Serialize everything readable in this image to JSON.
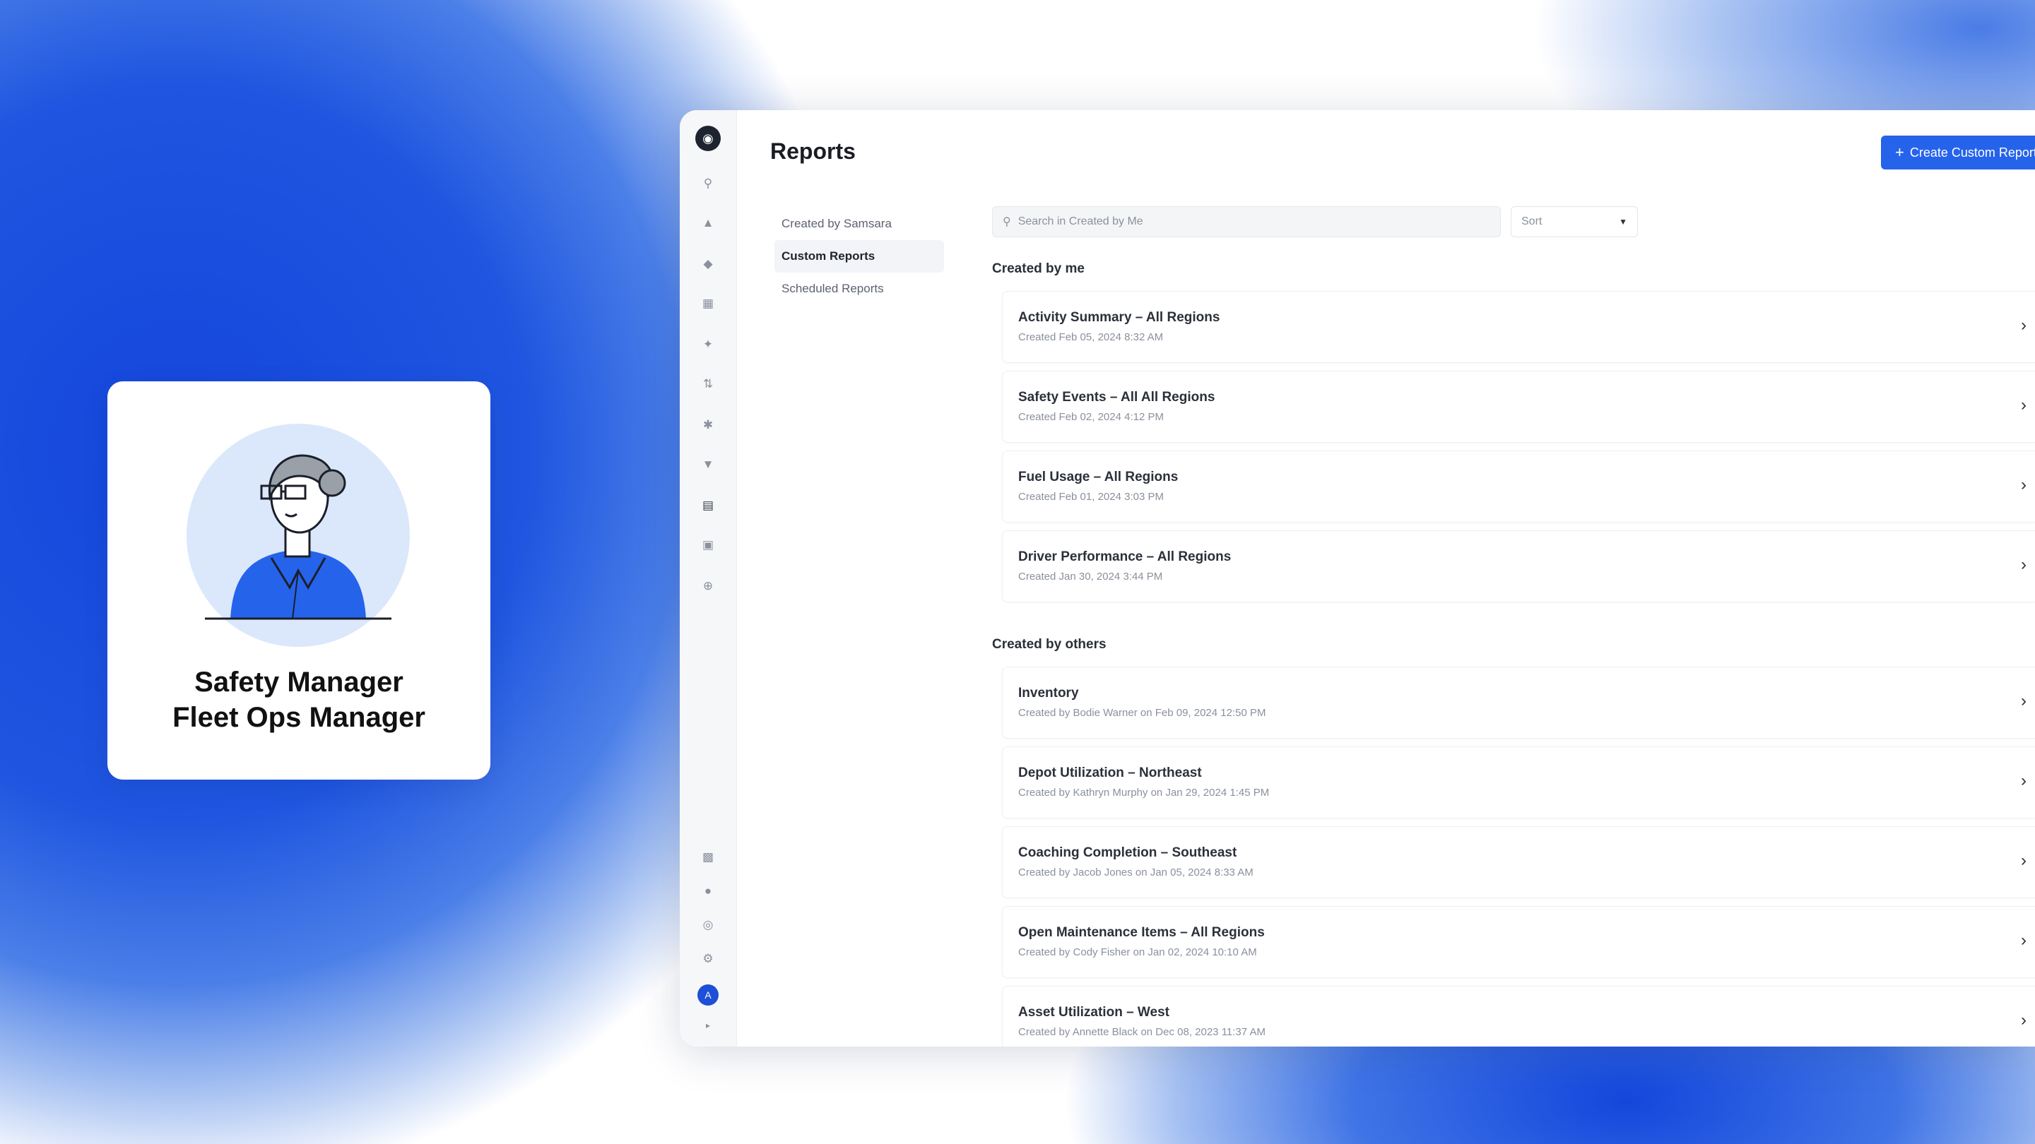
{
  "persona": {
    "roles": [
      "Safety Manager",
      "Fleet Ops Manager"
    ]
  },
  "app": {
    "page_title": "Reports",
    "create_button": "Create Custom Report",
    "subnav": [
      "Created by Samsara",
      "Custom Reports",
      "Scheduled Reports"
    ],
    "active_subnav": "Custom Reports",
    "search_placeholder": "Search in Created by Me",
    "sort_label": "Sort",
    "sections": {
      "mine": {
        "heading": "Created by me",
        "reports": [
          {
            "name": "Activity Summary – All Regions",
            "meta": "Created Feb 05, 2024 8:32 AM"
          },
          {
            "name": "Safety Events – All All Regions",
            "meta": "Created Feb 02, 2024 4:12 PM"
          },
          {
            "name": "Fuel Usage – All Regions",
            "meta": "Created Feb 01, 2024 3:03 PM"
          },
          {
            "name": "Driver Performance – All Regions",
            "meta": "Created Jan 30, 2024 3:44 PM"
          }
        ]
      },
      "others": {
        "heading": "Created by others",
        "reports": [
          {
            "name": "Inventory",
            "meta": "Created by Bodie Warner on Feb 09, 2024 12:50 PM"
          },
          {
            "name": "Depot Utilization – Northeast",
            "meta": "Created by Kathryn Murphy on Jan 29, 2024 1:45 PM"
          },
          {
            "name": "Coaching Completion – Southeast",
            "meta": "Created by Jacob Jones on Jan 05, 2024 8:33 AM"
          },
          {
            "name": "Open Maintenance Items – All Regions",
            "meta": "Created by Cody Fisher on Jan 02, 2024 10:10 AM"
          },
          {
            "name": "Asset Utilization – West",
            "meta": "Created by Annette Black on Dec 08, 2023 11:37 AM"
          }
        ]
      }
    },
    "rail_icons": [
      "search-icon",
      "truck-icon",
      "shield-icon",
      "clipboard-icon",
      "wrench-icon",
      "route-icon",
      "gear-cog-icon",
      "compliance-icon",
      "reports-icon",
      "calendar-icon",
      "plus-box-icon"
    ],
    "rail_bottom_icons": [
      "chat-icon",
      "bell-icon",
      "globe-icon",
      "settings-icon"
    ],
    "user_initial": "A",
    "accent_color": "#2563eb"
  }
}
